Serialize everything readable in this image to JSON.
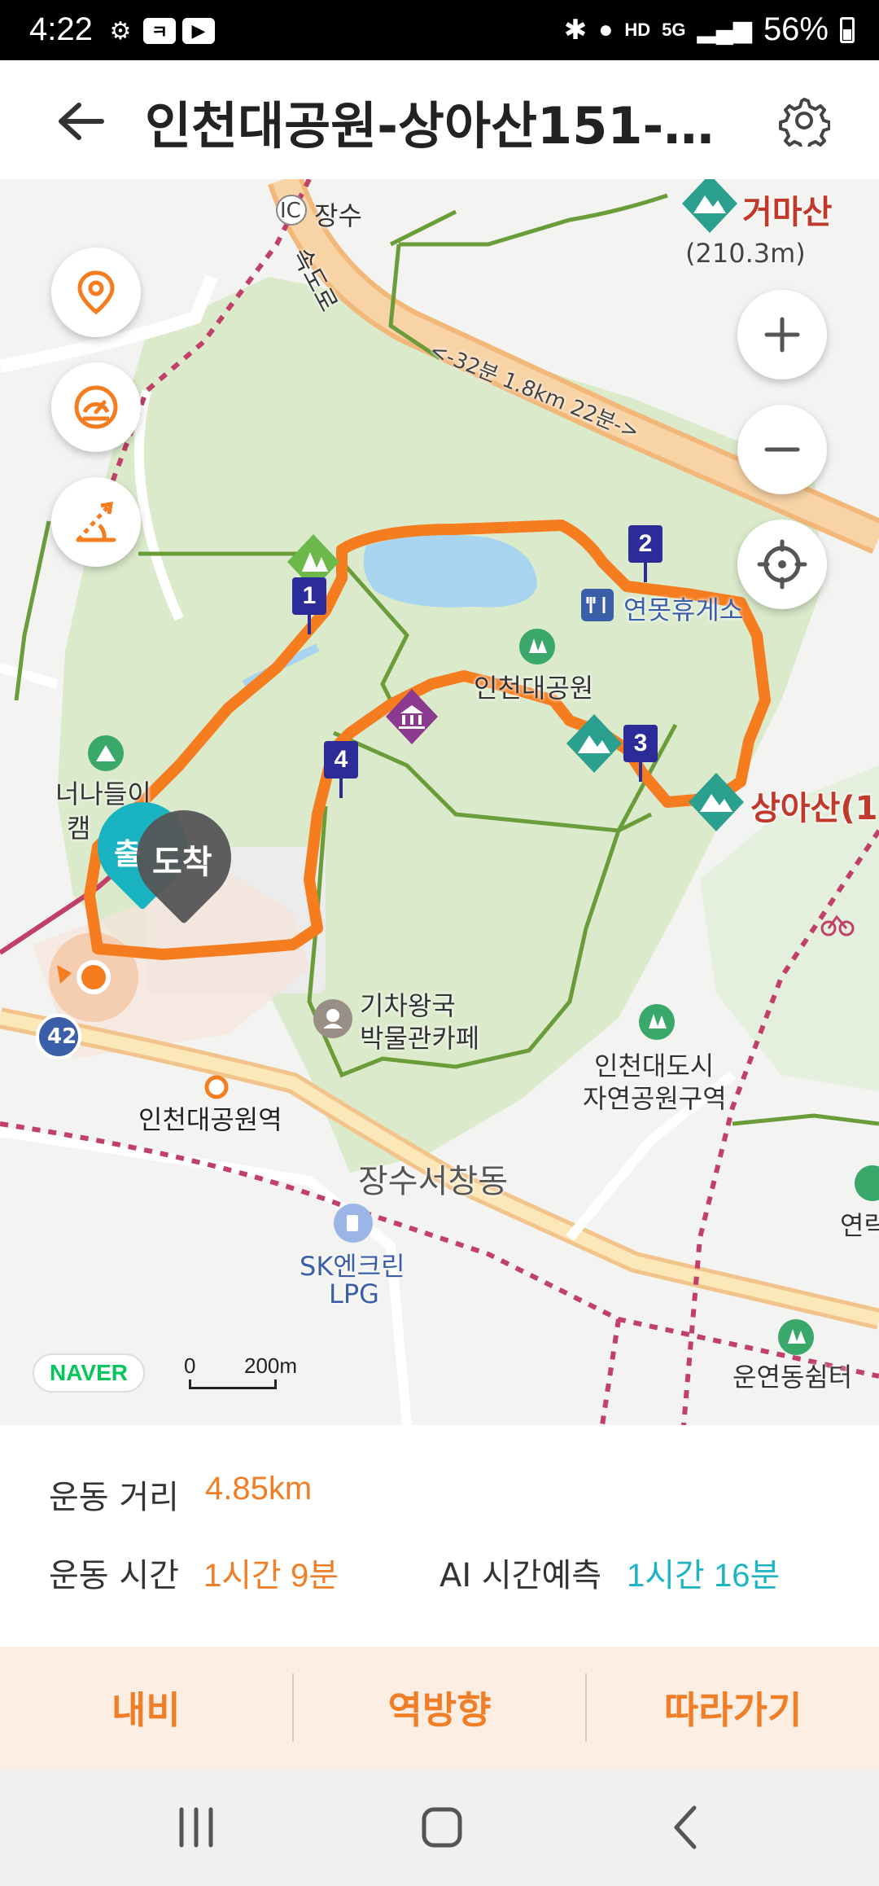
{
  "status_bar": {
    "time": "4:22",
    "battery": "56%",
    "signal_text": "5G",
    "hd_text": "HD"
  },
  "header": {
    "title": "인천대공원-상아산151-..."
  },
  "map": {
    "labels": {
      "jangsu": "장수",
      "ic": "IC",
      "highway": "속도로",
      "route_note": "<-32분 1.8km 22분->",
      "geomasan": "거마산",
      "geomasan_sub": "(210.3m)",
      "park": "인천대공원",
      "rest_area": "연못휴게소",
      "sangasan": "상아산(1",
      "camping1": "너나들이",
      "camping2": "캠",
      "train_museum1": "기차왕국",
      "train_museum2": "박물관카페",
      "nature_park1": "인천대도시",
      "nature_park2": "자연공원구역",
      "station": "인천대공원역",
      "district": "장수서창동",
      "gas1": "SK엔크린",
      "gas2": "LPG",
      "rest_shelter": "운연동쉼터",
      "yeon": "연락",
      "route42": "42"
    },
    "waypoints": [
      "1",
      "2",
      "3",
      "4"
    ],
    "start_label": "출",
    "end_label": "도착",
    "naver_logo": "NAVER",
    "scale_zero": "0",
    "scale_value": "200m",
    "colors": {
      "route": "#f57c1f",
      "park": "#d6e8c4",
      "trail": "#6a9c3a",
      "water": "#a8d4f0",
      "road": "#f5c58a",
      "rail": "#c0406a"
    }
  },
  "stats": {
    "distance_label": "운동 거리",
    "distance_value": "4.85km",
    "time_label": "운동 시간",
    "time_value": "1시간 9분",
    "ai_label": "AI 시간예측",
    "ai_value": "1시간 16분"
  },
  "actions": {
    "navigate": "내비",
    "reverse": "역방향",
    "follow": "따라가기"
  }
}
